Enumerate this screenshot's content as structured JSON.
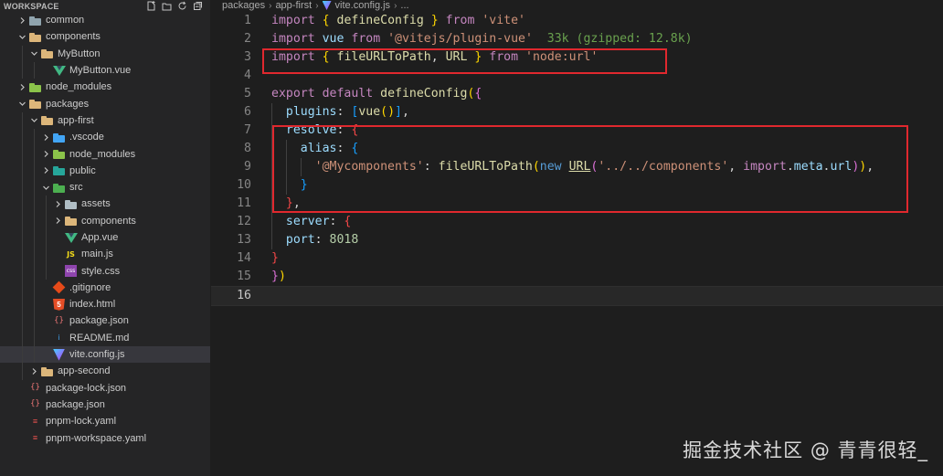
{
  "sidebar": {
    "title": "WORKSPACE",
    "items": [
      {
        "label": "common",
        "icon": "folder-common-icon",
        "depth": 0,
        "chev": "›",
        "kind": "f-gray"
      },
      {
        "label": "components",
        "icon": "folder-components-icon",
        "depth": 0,
        "chev": "⌄",
        "kind": "f-yellow"
      },
      {
        "label": "MyButton",
        "icon": "folder-icon",
        "depth": 1,
        "chev": "⌄",
        "kind": "f-yellow"
      },
      {
        "label": "MyButton.vue",
        "icon": "vue-file-icon",
        "depth": 2,
        "chev": "",
        "kind": "vue"
      },
      {
        "label": "node_modules",
        "icon": "folder-node-modules-icon",
        "depth": 0,
        "chev": "›",
        "kind": "f-green"
      },
      {
        "label": "packages",
        "icon": "folder-packages-icon",
        "depth": 0,
        "chev": "⌄",
        "kind": "f-yellow"
      },
      {
        "label": "app-first",
        "icon": "folder-icon",
        "depth": 1,
        "chev": "⌄",
        "kind": "f-yellow"
      },
      {
        "label": ".vscode",
        "icon": "folder-vscode-icon",
        "depth": 2,
        "chev": "›",
        "kind": "f-blue"
      },
      {
        "label": "node_modules",
        "icon": "folder-node-modules-icon",
        "depth": 2,
        "chev": "›",
        "kind": "f-green"
      },
      {
        "label": "public",
        "icon": "folder-public-icon",
        "depth": 2,
        "chev": "›",
        "kind": "f-pub"
      },
      {
        "label": "src",
        "icon": "folder-src-icon",
        "depth": 2,
        "chev": "⌄",
        "kind": "f-src"
      },
      {
        "label": "assets",
        "icon": "folder-assets-icon",
        "depth": 3,
        "chev": "›",
        "kind": "f-assets"
      },
      {
        "label": "components",
        "icon": "folder-components-icon",
        "depth": 3,
        "chev": "›",
        "kind": "f-yellow"
      },
      {
        "label": "App.vue",
        "icon": "vue-file-icon",
        "depth": 3,
        "chev": "",
        "kind": "vue"
      },
      {
        "label": "main.js",
        "icon": "js-file-icon",
        "depth": 3,
        "chev": "",
        "kind": "js"
      },
      {
        "label": "style.css",
        "icon": "css-file-icon",
        "depth": 3,
        "chev": "",
        "kind": "css"
      },
      {
        "label": ".gitignore",
        "icon": "git-file-icon",
        "depth": 2,
        "chev": "",
        "kind": "git"
      },
      {
        "label": "index.html",
        "icon": "html-file-icon",
        "depth": 2,
        "chev": "",
        "kind": "html"
      },
      {
        "label": "package.json",
        "icon": "json-file-icon",
        "depth": 2,
        "chev": "",
        "kind": "jsonred"
      },
      {
        "label": "README.md",
        "icon": "markdown-file-icon",
        "depth": 2,
        "chev": "",
        "kind": "md"
      },
      {
        "label": "vite.config.js",
        "icon": "vite-file-icon",
        "depth": 2,
        "chev": "",
        "kind": "vite",
        "selected": true
      },
      {
        "label": "app-second",
        "icon": "folder-icon",
        "depth": 1,
        "chev": "›",
        "kind": "f-yellow"
      },
      {
        "label": "package-lock.json",
        "icon": "json-file-icon",
        "depth": 0,
        "chev": "",
        "kind": "jsonred"
      },
      {
        "label": "package.json",
        "icon": "json-file-icon",
        "depth": 0,
        "chev": "",
        "kind": "jsonred"
      },
      {
        "label": "pnpm-lock.yaml",
        "icon": "yaml-file-icon",
        "depth": 0,
        "chev": "",
        "kind": "yaml"
      },
      {
        "label": "pnpm-workspace.yaml",
        "icon": "yaml-file-icon",
        "depth": 0,
        "chev": "",
        "kind": "yaml"
      }
    ]
  },
  "breadcrumb": {
    "parts": [
      "packages",
      "app-first",
      "vite.config.js",
      "..."
    ]
  },
  "editor": {
    "lines": [
      {
        "n": "1",
        "tokens": [
          [
            "kw",
            "import"
          ],
          [
            "plain",
            " "
          ],
          [
            "br1",
            "{"
          ],
          [
            "plain",
            " "
          ],
          [
            "fn",
            "defineConfig"
          ],
          [
            "plain",
            " "
          ],
          [
            "br1",
            "}"
          ],
          [
            "plain",
            " "
          ],
          [
            "kw",
            "from"
          ],
          [
            "plain",
            " "
          ],
          [
            "str",
            "'vite'"
          ]
        ]
      },
      {
        "n": "2",
        "tokens": [
          [
            "kw",
            "import"
          ],
          [
            "plain",
            " "
          ],
          [
            "id",
            "vue"
          ],
          [
            "plain",
            " "
          ],
          [
            "kw",
            "from"
          ],
          [
            "plain",
            " "
          ],
          [
            "str",
            "'@vitejs/plugin-vue'"
          ],
          [
            "plain",
            "  "
          ],
          [
            "hint",
            "33k (gzipped: 12.8k)"
          ]
        ]
      },
      {
        "n": "3",
        "tokens": [
          [
            "kw",
            "import"
          ],
          [
            "plain",
            " "
          ],
          [
            "br1",
            "{"
          ],
          [
            "plain",
            " "
          ],
          [
            "fn",
            "fileURLToPath"
          ],
          [
            "plain",
            ", "
          ],
          [
            "fn",
            "URL"
          ],
          [
            "plain",
            " "
          ],
          [
            "br1",
            "}"
          ],
          [
            "plain",
            " "
          ],
          [
            "kw",
            "from"
          ],
          [
            "plain",
            " "
          ],
          [
            "str",
            "'node:url'"
          ]
        ]
      },
      {
        "n": "4",
        "tokens": []
      },
      {
        "n": "5",
        "tokens": [
          [
            "kw",
            "export"
          ],
          [
            "plain",
            " "
          ],
          [
            "kw",
            "default"
          ],
          [
            "plain",
            " "
          ],
          [
            "fn",
            "defineConfig"
          ],
          [
            "br1",
            "("
          ],
          [
            "br2",
            "{"
          ]
        ]
      },
      {
        "n": "6",
        "tokens": [
          [
            "plain",
            "  "
          ],
          [
            "id",
            "plugins"
          ],
          [
            "plain",
            ": "
          ],
          [
            "br3",
            "["
          ],
          [
            "fn",
            "vue"
          ],
          [
            "br1",
            "()"
          ],
          [
            "br3",
            "]"
          ],
          [
            "plain",
            ","
          ]
        ]
      },
      {
        "n": "7",
        "tokens": [
          [
            "plain",
            "  "
          ],
          [
            "id",
            "resolve"
          ],
          [
            "plain",
            ": "
          ],
          [
            "kw-r",
            "{"
          ]
        ]
      },
      {
        "n": "8",
        "tokens": [
          [
            "plain",
            "    "
          ],
          [
            "id",
            "alias"
          ],
          [
            "plain",
            ": "
          ],
          [
            "br3",
            "{"
          ]
        ]
      },
      {
        "n": "9",
        "tokens": [
          [
            "plain",
            "      "
          ],
          [
            "str",
            "'@Mycomponents'"
          ],
          [
            "plain",
            ": "
          ],
          [
            "fn",
            "fileURLToPath"
          ],
          [
            "br1",
            "("
          ],
          [
            "k2",
            "new"
          ],
          [
            "plain",
            " "
          ],
          [
            "fn ul",
            "URL"
          ],
          [
            "br2",
            "("
          ],
          [
            "str",
            "'../../components'"
          ],
          [
            "plain",
            ", "
          ],
          [
            "kw",
            "import"
          ],
          [
            "plain",
            "."
          ],
          [
            "id",
            "meta"
          ],
          [
            "plain",
            "."
          ],
          [
            "id",
            "url"
          ],
          [
            "br2",
            ")"
          ],
          [
            "br1",
            ")"
          ],
          [
            "plain",
            ","
          ]
        ]
      },
      {
        "n": "10",
        "tokens": [
          [
            "plain",
            "    "
          ],
          [
            "br3",
            "}"
          ]
        ]
      },
      {
        "n": "11",
        "tokens": [
          [
            "plain",
            "  "
          ],
          [
            "kw-r",
            "}"
          ],
          [
            "plain",
            ","
          ]
        ]
      },
      {
        "n": "12",
        "tokens": [
          [
            "plain",
            "  "
          ],
          [
            "id",
            "server"
          ],
          [
            "plain",
            ": "
          ],
          [
            "kw-r",
            "{"
          ]
        ]
      },
      {
        "n": "13",
        "tokens": [
          [
            "plain",
            "  "
          ],
          [
            "id",
            "port"
          ],
          [
            "plain",
            ": "
          ],
          [
            "num",
            "8018"
          ]
        ]
      },
      {
        "n": "14",
        "tokens": [
          [
            "kw-r",
            "}"
          ]
        ]
      },
      {
        "n": "15",
        "tokens": [
          [
            "br2",
            "}"
          ],
          [
            "br1",
            ")"
          ]
        ]
      },
      {
        "n": "16",
        "tokens": [],
        "current": true
      }
    ]
  },
  "watermark": "掘金技术社区 @ 青青很轻_",
  "colors": {
    "highlight_box": "#e0282e",
    "background": "#1e1e1e",
    "sidebar_background": "#252526",
    "selected_row": "#37373d"
  }
}
